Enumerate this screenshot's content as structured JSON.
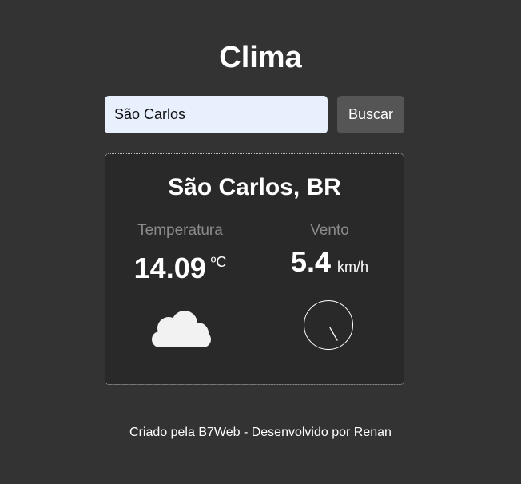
{
  "header": {
    "title": "Clima"
  },
  "search": {
    "value": "São Carlos",
    "button_label": "Buscar"
  },
  "result": {
    "city": "São Carlos, BR",
    "temperature": {
      "label": "Temperatura",
      "value": "14.09",
      "unit": "ºC"
    },
    "wind": {
      "label": "Vento",
      "value": "5.4",
      "unit": "km/h",
      "direction_deg": 150
    },
    "weather_icon": "cloud-icon",
    "colors": {
      "cloud": "#f2f2f2",
      "gauge": "#ffffff"
    }
  },
  "footer": {
    "text": "Criado pela B7Web - Desenvolvido por Renan"
  }
}
